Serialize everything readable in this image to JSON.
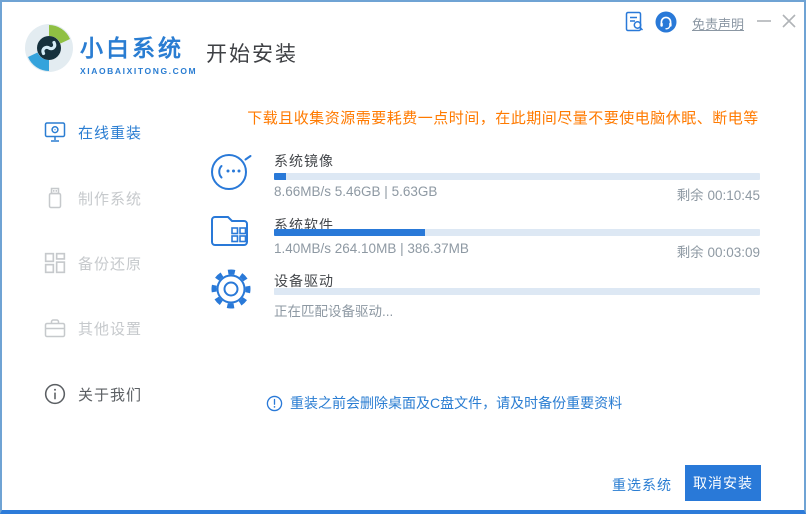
{
  "window": {
    "brand_name": "小白系统",
    "brand_domain": "XIAOBAIXITONG.COM",
    "page_title": "开始安装",
    "titlebar": {
      "disclaimer_link": "免责声明",
      "icons": [
        "file-search-icon",
        "support-headset-icon",
        "minimize-icon",
        "close-icon"
      ]
    }
  },
  "sidebar": {
    "items": [
      {
        "label": "在线重装",
        "icon": "monitor-icon",
        "state": "active"
      },
      {
        "label": "制作系统",
        "icon": "usb-icon",
        "state": "disabled"
      },
      {
        "label": "备份还原",
        "icon": "backup-icon",
        "state": "disabled"
      },
      {
        "label": "其他设置",
        "icon": "toolbox-icon",
        "state": "disabled"
      },
      {
        "label": "关于我们",
        "icon": "info-icon",
        "state": "normal"
      }
    ]
  },
  "main": {
    "warning": "下载且收集资源需要耗费一点时间，在此期间尽量不要使电脑休眠、断电等",
    "tasks": [
      {
        "name": "系统镜像",
        "icon": "mascot-face-icon",
        "progress_percent": 2.5,
        "detail": "8.66MB/s 5.46GB | 5.63GB",
        "remaining": "剩余 00:10:45"
      },
      {
        "name": "系统软件",
        "icon": "folder-apps-icon",
        "progress_percent": 31,
        "detail": "1.40MB/s 264.10MB | 386.37MB",
        "remaining": "剩余 00:03:09"
      },
      {
        "name": "设备驱动",
        "icon": "gear-icon",
        "progress_percent": 0,
        "detail": "正在匹配设备驱动...",
        "remaining": ""
      }
    ],
    "note": "重装之前会删除桌面及C盘文件，请及时备份重要资料"
  },
  "footer": {
    "reselect_label": "重选系统",
    "cancel_label": "取消安装"
  },
  "colors": {
    "primary_blue": "#2979d8",
    "warning_orange": "#ff7a00",
    "progress_track": "#dde8f4",
    "muted_text": "#8e99a3",
    "border_blue": "#6fa3d4",
    "border_bottom_blue": "#2d7bd9"
  }
}
